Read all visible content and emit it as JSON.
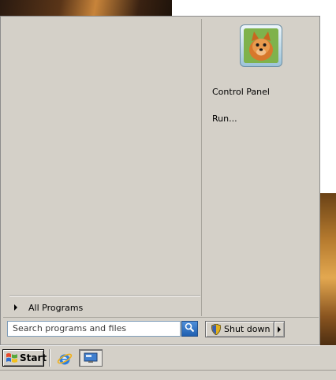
{
  "start_menu": {
    "all_programs_label": "All Programs",
    "right_items": [
      {
        "label": "Control Panel"
      },
      {
        "label": "Run..."
      }
    ],
    "search": {
      "placeholder": "Search programs and files"
    },
    "shutdown_label": "Shut down",
    "user_picture_icon": "dog-avatar-icon"
  },
  "taskbar": {
    "start_label": "Start",
    "quick_launch": [
      {
        "icon": "internet-explorer-icon"
      },
      {
        "icon": "show-desktop-icon"
      }
    ]
  }
}
